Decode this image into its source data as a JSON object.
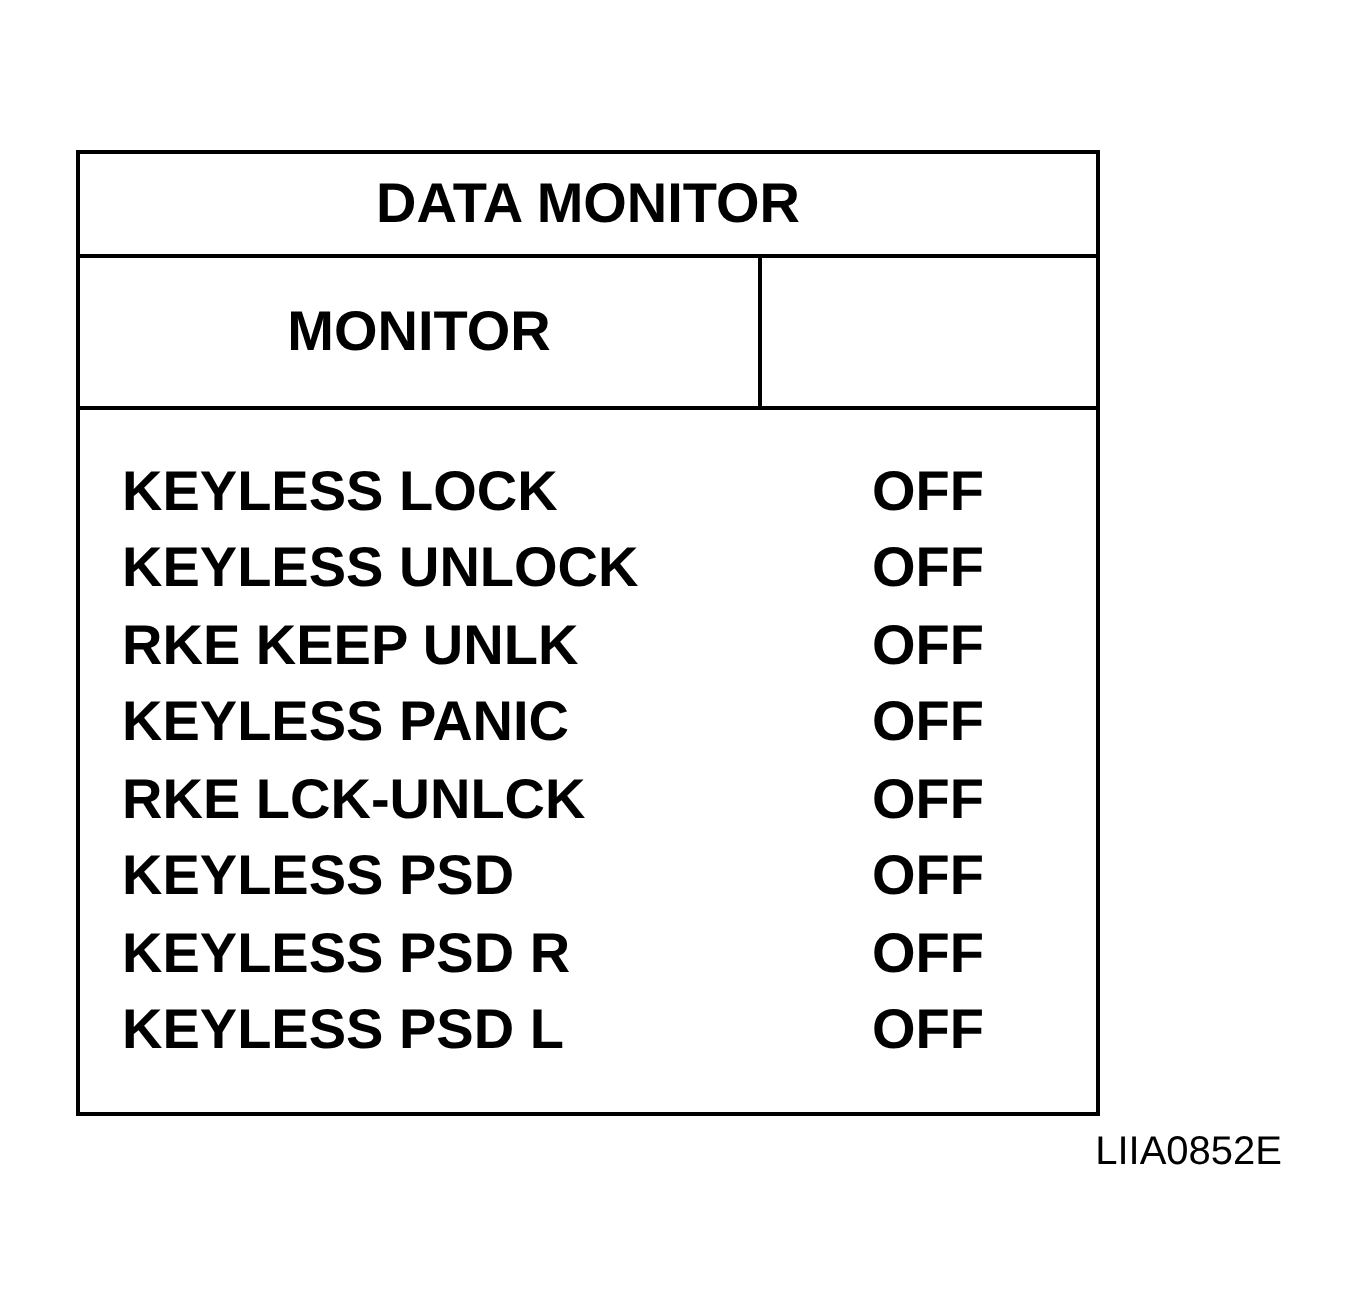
{
  "title": "DATA MONITOR",
  "header": {
    "column_1": "MONITOR"
  },
  "rows": [
    {
      "item": "KEYLESS LOCK",
      "value": "OFF"
    },
    {
      "item": "KEYLESS UNLOCK",
      "value": "OFF"
    },
    {
      "item": "RKE KEEP UNLK",
      "value": "OFF"
    },
    {
      "item": "KEYLESS PANIC",
      "value": "OFF"
    },
    {
      "item": "RKE LCK-UNLCK",
      "value": "OFF"
    },
    {
      "item": "KEYLESS PSD",
      "value": "OFF"
    },
    {
      "item": "KEYLESS PSD R",
      "value": "OFF"
    },
    {
      "item": "KEYLESS PSD L",
      "value": "OFF"
    }
  ],
  "figure_code": "LIIA0852E"
}
